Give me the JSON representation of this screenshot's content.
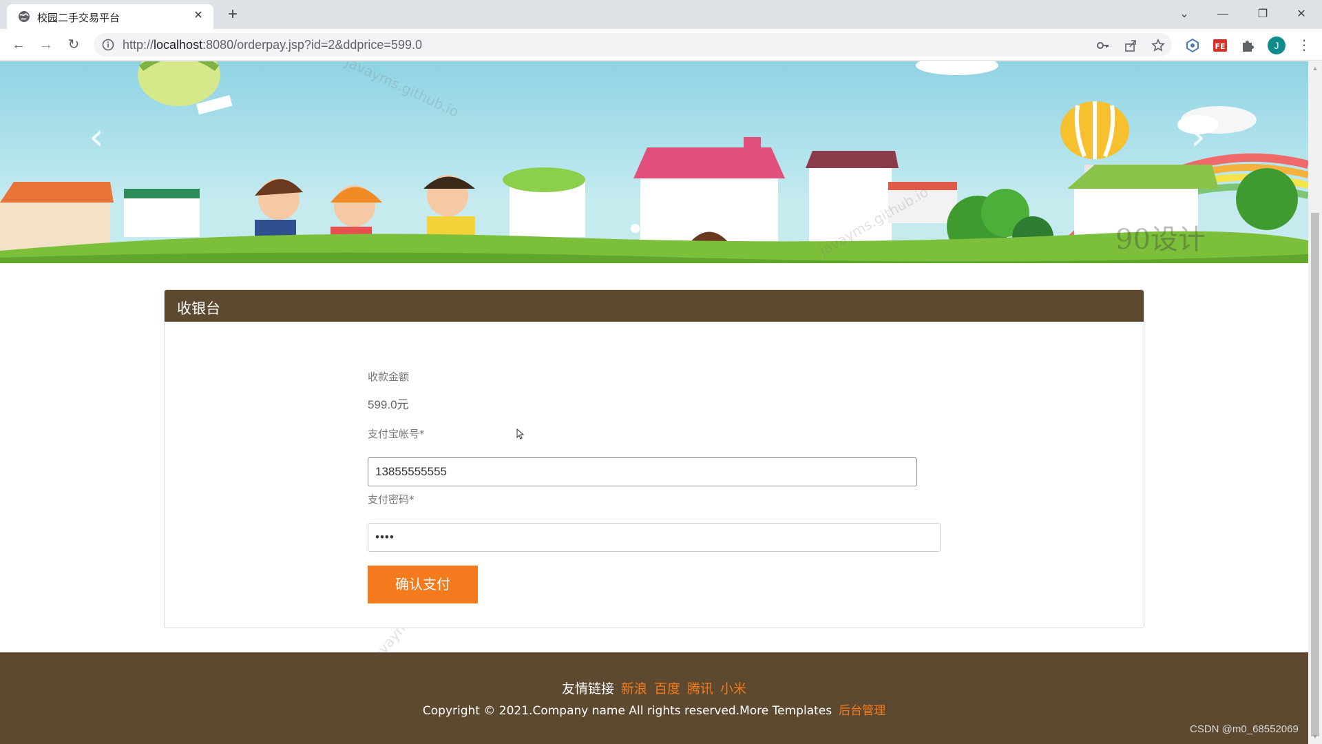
{
  "browser": {
    "tab_title": "校园二手交易平台",
    "tab_close": "✕",
    "new_tab": "+",
    "url_prefix": "http://",
    "url_host": "localhost",
    "url_rest": ":8080/orderpay.jsp?id=2&ddprice=599.0",
    "window_controls": {
      "list": "⌄",
      "minimize": "—",
      "restore": "❐",
      "close": "✕"
    },
    "nav": {
      "back": "←",
      "forward": "→",
      "reload": "↻"
    },
    "avatar_letter": "J",
    "menu": "⋮",
    "icons": [
      "info-icon",
      "key-icon",
      "share-icon",
      "star-icon",
      "extension-shield-icon",
      "fe-extension-icon",
      "puzzle-icon"
    ]
  },
  "banner": {
    "prev": "‹",
    "next": "›",
    "slides": 3,
    "active_slide": 1,
    "watermark_text": "90设计"
  },
  "watermark": "javayms.github.io",
  "cashier": {
    "title": "收银台",
    "amount_label": "收款金额",
    "amount_value": "599.0元",
    "account_label": "支付宝帐号*",
    "account_value": "13855555555",
    "password_label": "支付密码*",
    "password_value": "••••",
    "pay_button": "确认支付"
  },
  "footer": {
    "links_label": "友情链接",
    "links": [
      "新浪",
      "百度",
      "腾讯",
      "小米"
    ],
    "copyright": "Copyright © 2021.Company name All rights reserved.More Templates",
    "admin_link": "后台管理"
  },
  "csdn_watermark": "CSDN @m0_68552069",
  "colors": {
    "header_brown": "#5c4930",
    "accent_orange": "#f37b1d"
  }
}
